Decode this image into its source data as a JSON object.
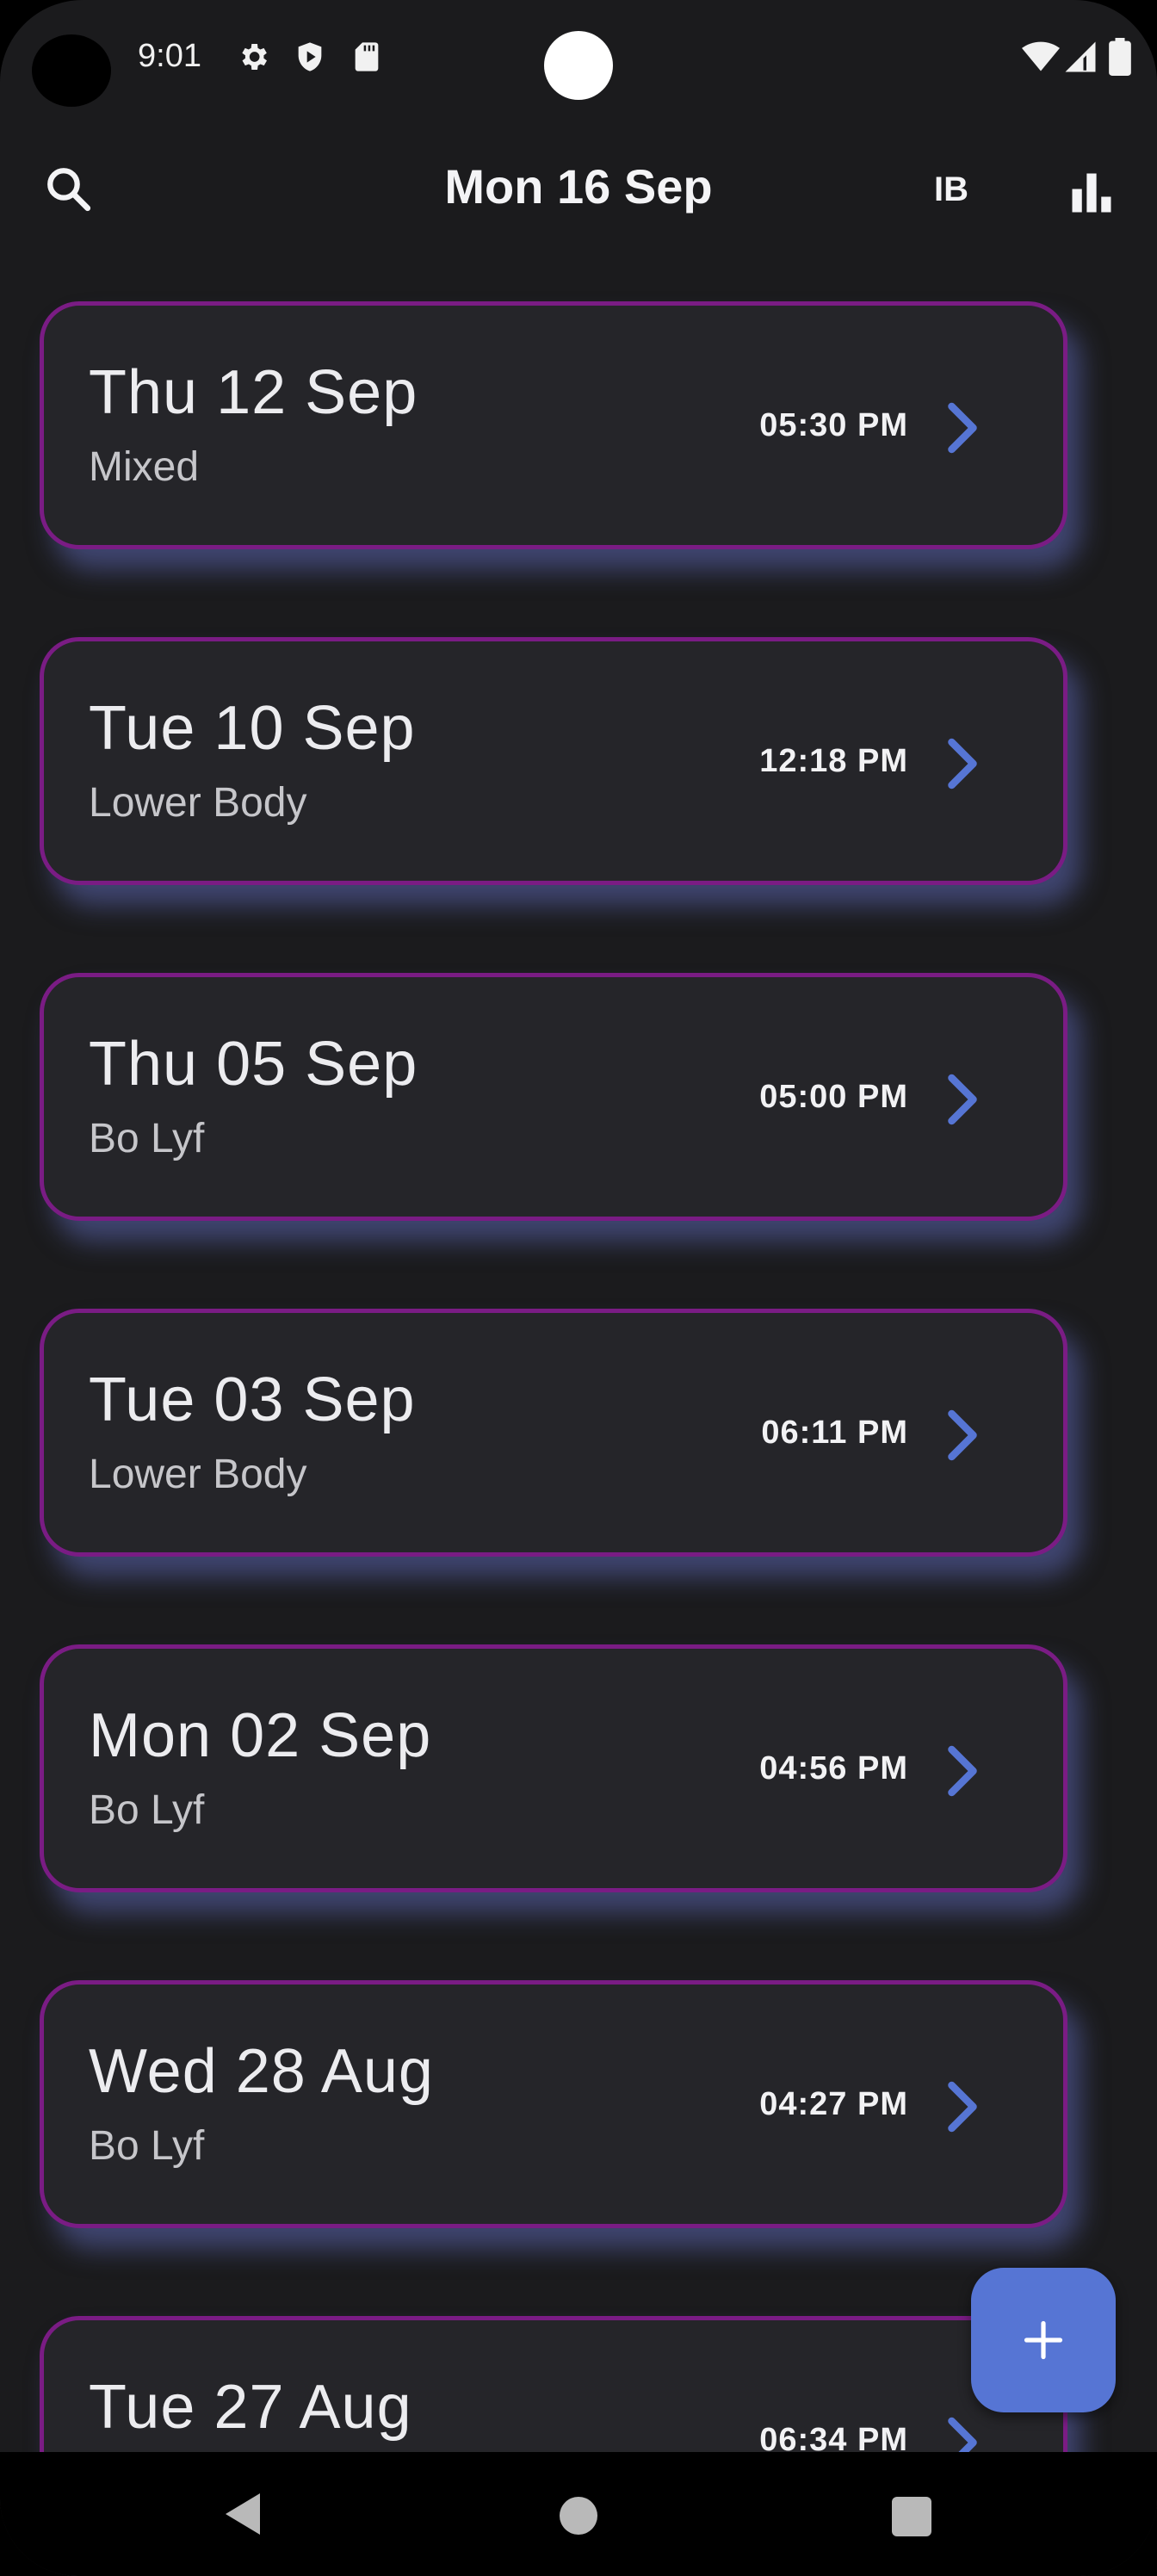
{
  "status_bar": {
    "time": "9:01",
    "left_icons": [
      "settings-icon",
      "shield-play-icon",
      "sd-card-icon"
    ],
    "right_icons": [
      "wifi-icon",
      "signal-icon",
      "battery-icon"
    ]
  },
  "app_bar": {
    "title": "Mon 16 Sep",
    "initials": "IB",
    "icons": [
      "search-icon",
      "bar-chart-icon"
    ]
  },
  "sessions": [
    {
      "date": "Thu 12 Sep",
      "label": "Mixed",
      "time": "05:30 PM"
    },
    {
      "date": "Tue 10 Sep",
      "label": "Lower Body",
      "time": "12:18 PM"
    },
    {
      "date": "Thu 05 Sep",
      "label": "Bo Lyf",
      "time": "05:00 PM"
    },
    {
      "date": "Tue 03 Sep",
      "label": "Lower Body",
      "time": "06:11 PM"
    },
    {
      "date": "Mon 02 Sep",
      "label": "Bo Lyf",
      "time": "04:56 PM"
    },
    {
      "date": "Wed 28 Aug",
      "label": "Bo Lyf",
      "time": "04:27 PM"
    },
    {
      "date": "Tue 27 Aug",
      "label": "",
      "time": "06:34 PM"
    }
  ],
  "fab": {
    "icon": "plus-icon"
  },
  "colors": {
    "background": "#1b1b1d",
    "card": "#252529",
    "card_border": "#7a1c84",
    "accent": "#5675d4"
  }
}
